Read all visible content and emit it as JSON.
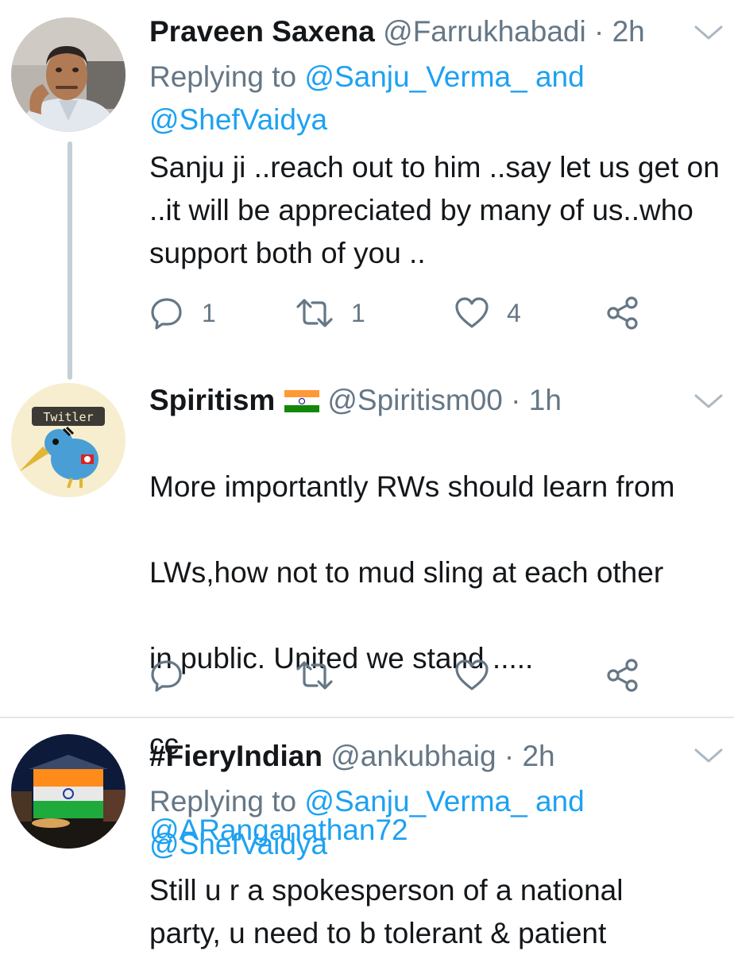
{
  "tweets": [
    {
      "display_name": "Praveen Saxena",
      "handle": "@Farrukhabadi",
      "separator": "·",
      "time": "2h",
      "replying_prefix": "Replying to",
      "replying_user1": "@Sanju_Verma_",
      "replying_and": "and",
      "replying_user2": "@ShefVaidya",
      "text": "Sanju ji ..reach out to him ..say let us get on ..it will  be appreciated by many of us..who support both of you ..",
      "reply_count": "1",
      "retweet_count": "1",
      "like_count": "4"
    },
    {
      "display_name": "Spiritism",
      "flag": "indian-flag-emoji",
      "handle": "@Spiritism00",
      "separator": "·",
      "time": "1h",
      "text_line1": "More importantly RWs should learn from",
      "text_line2": "LWs,how not to mud sling at each other",
      "text_line3": "in public. United we stand .....",
      "text_line4": "cc",
      "mention": "@ARanganathan72",
      "avatar_label": "Twitler"
    },
    {
      "display_name": "#FieryIndian",
      "handle": "@ankubhaig",
      "separator": "·",
      "time": "2h",
      "replying_prefix": "Replying to",
      "replying_user1": "@Sanju_Verma_",
      "replying_and": "and",
      "replying_user2": "@ShefVaidya",
      "text": "Still u r a spokesperson of a national party, u need to b tolerant & patient"
    }
  ],
  "icons": {
    "reply": "reply-icon",
    "retweet": "retweet-icon",
    "like": "heart-icon",
    "share": "share-icon",
    "menu": "chevron-down-icon"
  },
  "colors": {
    "link": "#1da1f2",
    "muted": "#657786",
    "text": "#14171a",
    "thread_line": "#c4cfd6",
    "divider": "#e1e8ed"
  }
}
